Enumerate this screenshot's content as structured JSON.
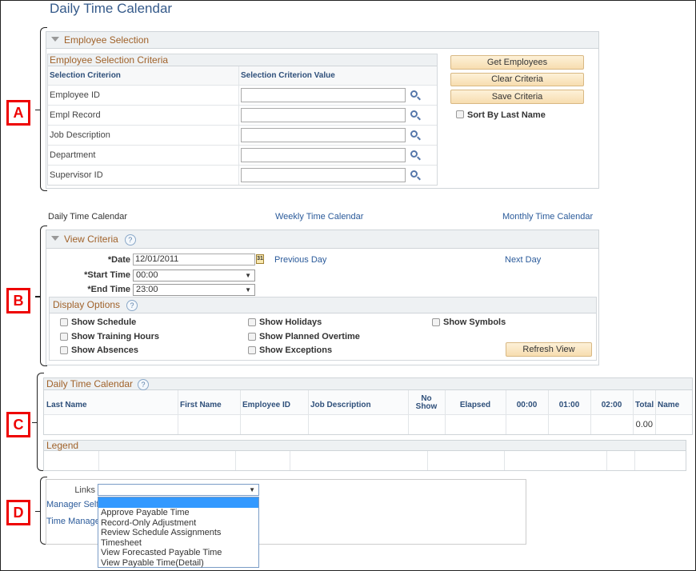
{
  "page": {
    "title": "Daily Time Calendar"
  },
  "annotations": [
    "A",
    "B",
    "C",
    "D"
  ],
  "employee_selection": {
    "title": "Employee Selection",
    "criteria_title": "Employee Selection Criteria",
    "col_criterion": "Selection Criterion",
    "col_value": "Selection Criterion Value",
    "rows": [
      {
        "label": "Employee ID",
        "value": ""
      },
      {
        "label": "Empl Record",
        "value": ""
      },
      {
        "label": "Job Description",
        "value": ""
      },
      {
        "label": "Department",
        "value": ""
      },
      {
        "label": "Supervisor ID",
        "value": ""
      }
    ],
    "get_employees": "Get Employees",
    "clear_criteria": "Clear Criteria",
    "save_criteria": "Save Criteria",
    "sort_by_last_name": "Sort By Last Name",
    "sort_checked": false
  },
  "nav": {
    "daily": "Daily Time Calendar",
    "weekly": "Weekly Time Calendar",
    "monthly": "Monthly Time Calendar"
  },
  "view_criteria": {
    "title": "View Criteria",
    "help": "?",
    "date_label": "*Date",
    "date_value": "12/01/2011",
    "calendar_icon": "31",
    "previous_day": "Previous Day",
    "next_day": "Next Day",
    "start_label": "*Start Time",
    "start_value": "00:00",
    "end_label": "*End Time",
    "end_value": "23:00",
    "display_options": "Display Options",
    "options": [
      {
        "label": "Show Schedule",
        "checked": false
      },
      {
        "label": "Show Training Hours",
        "checked": false
      },
      {
        "label": "Show Absences",
        "checked": false
      },
      {
        "label": "Show Holidays",
        "checked": false
      },
      {
        "label": "Show Planned Overtime",
        "checked": false
      },
      {
        "label": "Show Exceptions",
        "checked": false
      },
      {
        "label": "Show Symbols",
        "checked": false
      }
    ],
    "refresh": "Refresh View"
  },
  "calendar_grid": {
    "title": "Daily Time Calendar",
    "columns": [
      "Last Name",
      "First Name",
      "Employee ID",
      "Job Description",
      "No Show",
      "Elapsed",
      "00:00",
      "01:00",
      "02:00",
      "Total",
      "Name"
    ],
    "row": [
      "",
      "",
      "",
      "",
      "",
      "",
      "",
      "",
      "",
      "0.00",
      ""
    ]
  },
  "legend": {
    "title": "Legend"
  },
  "links": {
    "label": "Links",
    "value": "",
    "manager_self": "Manager Self",
    "time_manage": "Time Manage",
    "options": [
      "",
      "Approve Payable Time",
      "Record-Only Adjustment",
      "Review Schedule Assignments",
      "Timesheet",
      "View Forecasted Payable Time",
      "View Payable Time(Detail)"
    ]
  }
}
